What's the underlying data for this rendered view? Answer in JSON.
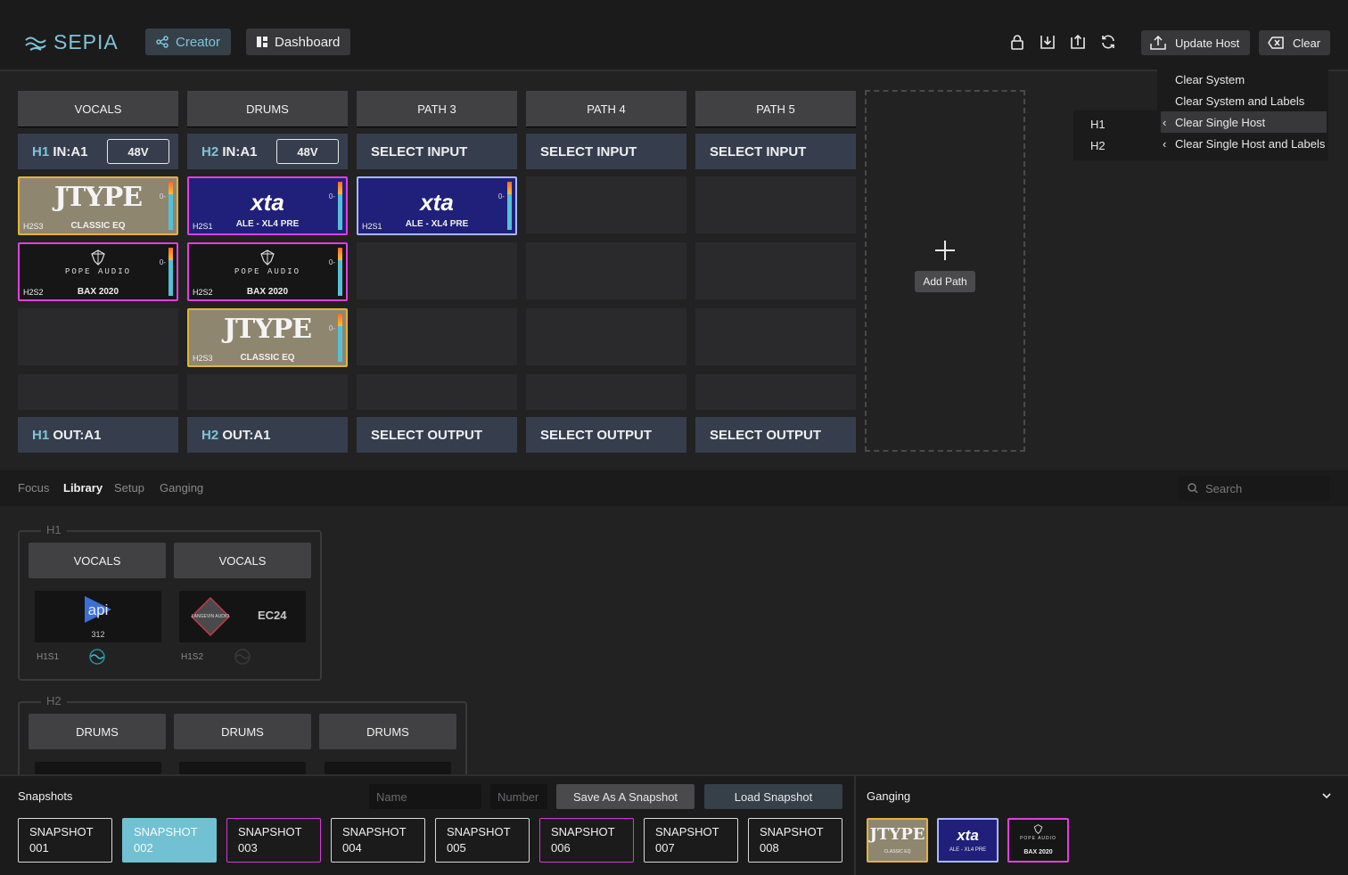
{
  "app": {
    "name": "SEPIA",
    "brand_color": "#7fc4d8"
  },
  "nav": {
    "creator": "Creator",
    "dashboard": "Dashboard"
  },
  "header": {
    "update_host": "Update Host",
    "clear": "Clear",
    "icons": [
      "lock-icon",
      "import-icon",
      "export-icon",
      "refresh-icon"
    ]
  },
  "clear_menu": {
    "hosts": [
      "H1",
      "H2"
    ],
    "items": [
      "Clear System",
      "Clear System and Labels",
      "Clear Single Host",
      "Clear Single Host and Labels"
    ]
  },
  "paths": [
    {
      "name": "VOCALS",
      "host": "H1",
      "input": "IN:A1",
      "phantom": "48V",
      "output_host": "H1",
      "output": "OUT:A1"
    },
    {
      "name": "DRUMS",
      "host": "H2",
      "input": "IN:A1",
      "phantom": "48V",
      "output_host": "H2",
      "output": "OUT:A1"
    },
    {
      "name": "PATH 3",
      "input": "SELECT INPUT",
      "output": "SELECT OUTPUT"
    },
    {
      "name": "PATH 4",
      "input": "SELECT INPUT",
      "output": "SELECT OUTPUT"
    },
    {
      "name": "PATH 5",
      "input": "SELECT INPUT",
      "output": "SELECT OUTPUT"
    }
  ],
  "plugins": {
    "p1_1": {
      "brand": "JTYPE",
      "name": "CLASSIC EQ",
      "slot": "H2S3",
      "meter": "0-"
    },
    "p1_2": {
      "brand": "POPE AUDIO",
      "name": "BAX 2020",
      "slot": "H2S2",
      "meter": "0-"
    },
    "p2_1": {
      "brand": "xta",
      "name": "ALE - XL4 PRE",
      "slot": "H2S1",
      "meter": "0-"
    },
    "p2_2": {
      "brand": "POPE AUDIO",
      "name": "BAX 2020",
      "slot": "H2S2",
      "meter": "0-"
    },
    "p2_3": {
      "brand": "JTYPE",
      "name": "CLASSIC EQ",
      "slot": "H2S3",
      "meter": "0-"
    },
    "p3_1": {
      "brand": "xta",
      "name": "ALE - XL4 PRE",
      "slot": "H2S1",
      "meter": "0-"
    }
  },
  "add_path": "Add Path",
  "tabs": [
    "Focus",
    "Library",
    "Setup",
    "Ganging"
  ],
  "selected_tab": "Library",
  "search": {
    "placeholder": "Search"
  },
  "library": {
    "h1": {
      "label": "H1",
      "paths": [
        "VOCALS",
        "VOCALS"
      ],
      "tiles": [
        {
          "brand": "api",
          "model": "312",
          "slot": "H1S1"
        },
        {
          "brand": "LANGEVIN AUDIO",
          "model": "EC24",
          "slot": "H1S2"
        }
      ]
    },
    "h2": {
      "label": "H2",
      "paths": [
        "DRUMS",
        "DRUMS",
        "DRUMS"
      ]
    }
  },
  "snapshots": {
    "title": "Snapshots",
    "name_placeholder": "Name",
    "number_placeholder": "Number",
    "save": "Save As A Snapshot",
    "load": "Load Snapshot",
    "items": [
      [
        "SNAPSHOT",
        "001"
      ],
      [
        "SNAPSHOT",
        "002"
      ],
      [
        "SNAPSHOT",
        "003"
      ],
      [
        "SNAPSHOT",
        "004"
      ],
      [
        "SNAPSHOT",
        "005"
      ],
      [
        "SNAPSHOT",
        "006"
      ],
      [
        "SNAPSHOT",
        "007"
      ],
      [
        "SNAPSHOT",
        "008"
      ]
    ]
  },
  "ganging": {
    "title": "Ganging",
    "tiles": [
      {
        "brand": "JTYPE",
        "name": "CLASSIC EQ"
      },
      {
        "brand": "xta",
        "name": "ALE - XL4 PRE"
      },
      {
        "brand": "POPE AUDIO",
        "name": "BAX 2020"
      }
    ]
  }
}
